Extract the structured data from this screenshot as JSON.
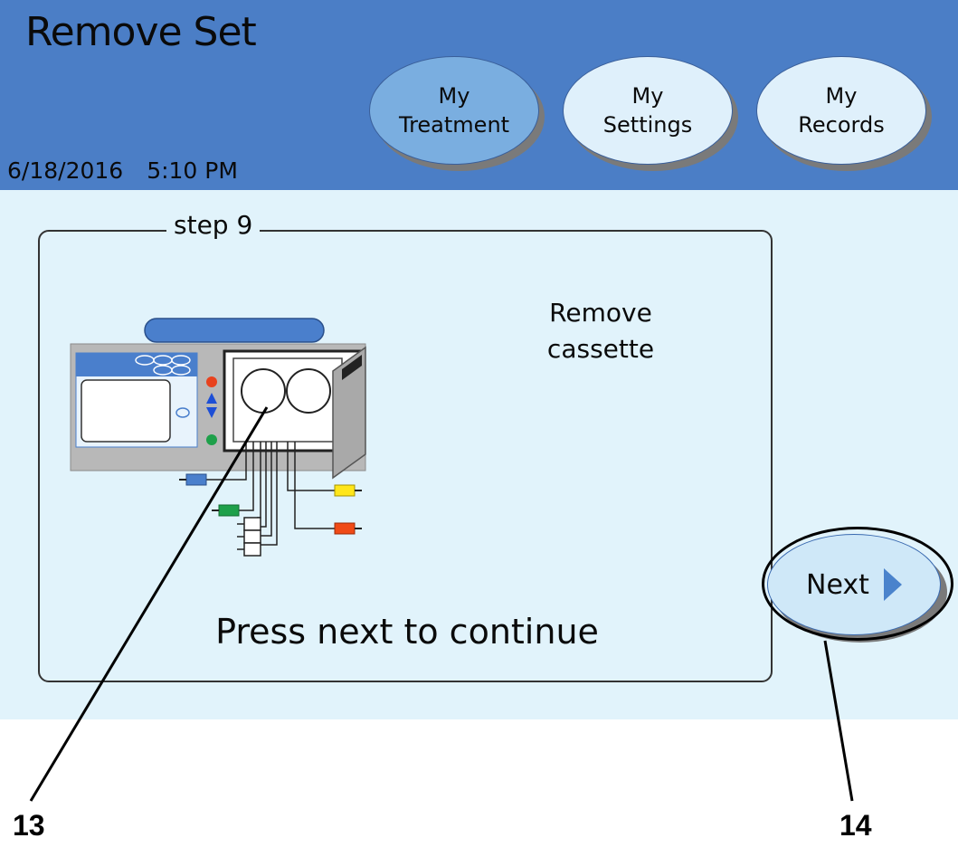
{
  "header": {
    "title": "Remove Set",
    "date": "6/18/2016",
    "time": "5:10 PM",
    "nav": [
      {
        "line1": "My",
        "line2": "Treatment",
        "active": true
      },
      {
        "line1": "My",
        "line2": "Settings",
        "active": false
      },
      {
        "line1": "My",
        "line2": "Records",
        "active": false
      }
    ]
  },
  "step": {
    "label": "step 9",
    "instruction_line1": "Remove",
    "instruction_line2": "cassette",
    "continue_text": "Press next to continue"
  },
  "next_button": {
    "label": "Next",
    "icon": "triangle-right-icon"
  },
  "callouts": {
    "cassette": "13",
    "next": "14"
  },
  "colors": {
    "header_bg": "#4b7ec6",
    "screen_bg": "#e1f3fb",
    "active_nav": "#7aaee0",
    "inactive_nav": "#dff0fb"
  }
}
